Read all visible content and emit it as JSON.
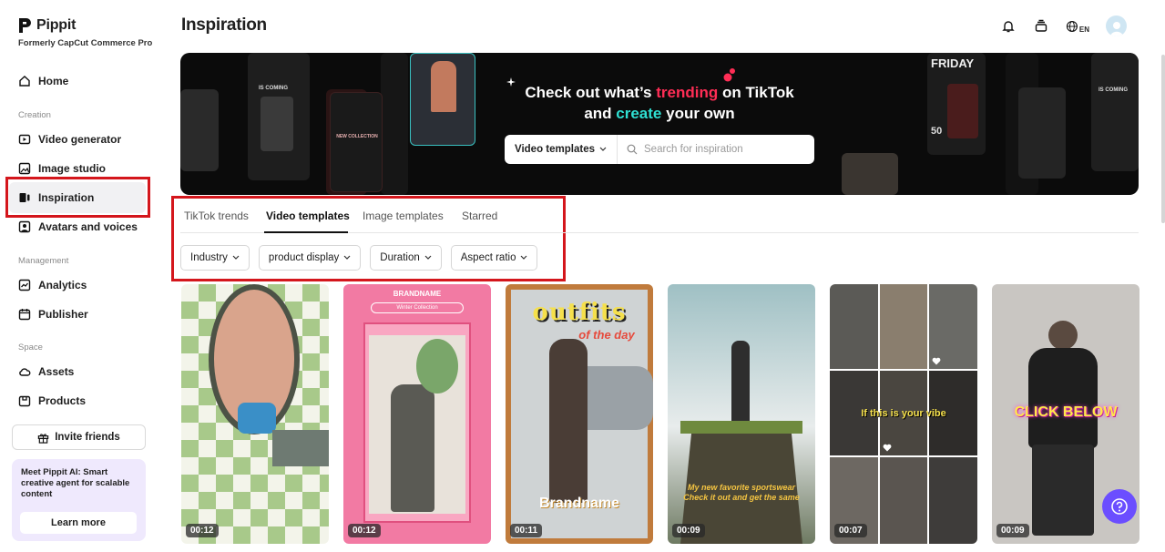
{
  "brand": {
    "name": "Pippit",
    "subtitle": "Formerly CapCut Commerce Pro"
  },
  "sidebar": {
    "home": "Home",
    "sections": {
      "creation": "Creation",
      "management": "Management",
      "space": "Space"
    },
    "creation_items": [
      "Video generator",
      "Image studio",
      "Inspiration",
      "Avatars and voices"
    ],
    "management_items": [
      "Analytics",
      "Publisher"
    ],
    "space_items": [
      "Assets",
      "Products"
    ],
    "invite": "Invite friends",
    "promo_text": "Meet Pippit AI: Smart creative agent for scalable content",
    "promo_button": "Learn more"
  },
  "header": {
    "title": "Inspiration",
    "lang": "EN"
  },
  "banner": {
    "line1_pre": "Check out what’s ",
    "line1_highlight": "trending",
    "line1_post": " on TikTok",
    "line2_pre": "and ",
    "line2_highlight": "create",
    "line2_post": " your own",
    "search_select": "Video templates",
    "search_placeholder": "Search for inspiration",
    "tile_text": {
      "coming": "IS COMING",
      "friday": "FRIDAY",
      "fifty": "50",
      "new_collection": "NEW COLLECTION"
    }
  },
  "tabs": [
    "TikTok trends",
    "Video templates",
    "Image templates",
    "Starred"
  ],
  "filters": [
    "Industry",
    "product display",
    "Duration",
    "Aspect ratio"
  ],
  "cards": [
    {
      "duration": "00:12"
    },
    {
      "duration": "00:12",
      "brand": "BRANDNAME",
      "search": "Winter Collection"
    },
    {
      "duration": "00:11",
      "title": "outfits",
      "sub": "of the day",
      "footer": "Brandname"
    },
    {
      "duration": "00:09",
      "caption": "My new favorite sportswear Check it out and get the same"
    },
    {
      "duration": "00:07",
      "caption": "If this is your vibe"
    },
    {
      "duration": "00:09",
      "caption": "CLICK BELOW"
    }
  ],
  "colors": {
    "accent_red": "#d4161c",
    "help_purple": "#6b4eff",
    "trending": "#ff2d55",
    "create": "#2fe0d3"
  }
}
